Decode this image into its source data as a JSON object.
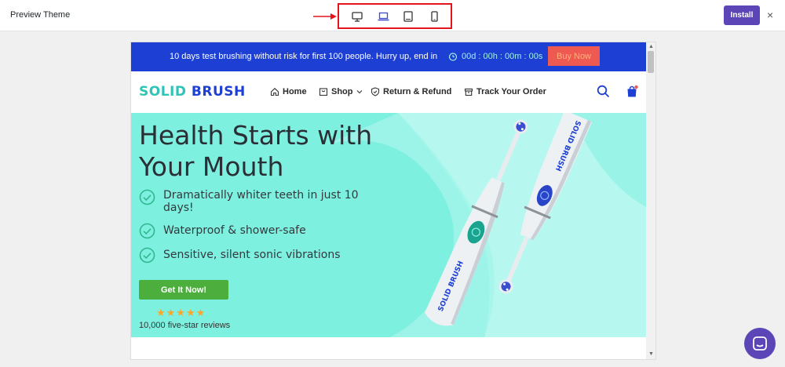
{
  "topbar": {
    "title": "Preview Theme",
    "install_label": "Install",
    "close_symbol": "×",
    "devices": [
      "desktop-icon",
      "laptop-icon",
      "tablet-icon",
      "mobile-icon"
    ]
  },
  "site": {
    "announcement": {
      "message": "10 days test brushing without risk for first 100 people. Hurry up, end in",
      "countdown": "00d : 00h : 00m : 00s",
      "buy_label": "Buy Now"
    },
    "logo": {
      "part1": "SOLID",
      "part2": "BRUSH"
    },
    "nav": {
      "home": "Home",
      "shop": "Shop",
      "refund": "Return & Refund",
      "track": "Track Your Order"
    },
    "hero": {
      "title": "Health Starts with Your Mouth",
      "features": [
        "Dramatically whiter teeth in just 10 days!",
        "Waterproof & shower-safe",
        "Sensitive, silent sonic vibrations"
      ],
      "cta_label": "Get It Now!",
      "stars": "★★★★★",
      "reviews": "10,000 five-star reviews",
      "product_brand": "SOLID BRUSH"
    }
  },
  "colors": {
    "accent": "#5b45b7",
    "announcement_bg": "#1d3fd3",
    "hero_bg": "#7ef0e0",
    "cta_green": "#4caf3d",
    "buy_red": "#ee5a52",
    "logo_teal": "#2ec4b6"
  }
}
